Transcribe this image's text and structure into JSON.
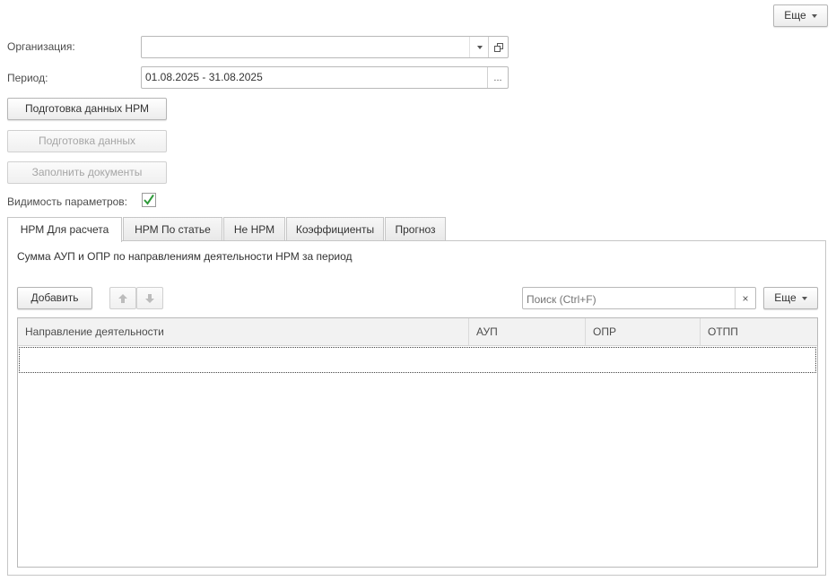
{
  "top_more": {
    "label": "Еще"
  },
  "form": {
    "organization": {
      "label": "Организация:",
      "value": ""
    },
    "period": {
      "label": "Период:",
      "value": "01.08.2025 - 31.08.2025",
      "button": "..."
    },
    "buttons": {
      "prepare_nrm": "Подготовка данных НРМ",
      "prepare_data": "Подготовка данных",
      "fill_docs": "Заполнить документы"
    },
    "visibility": {
      "label": "Видимость параметров:",
      "checked": true
    }
  },
  "tabs": [
    {
      "label": "НРМ Для расчета",
      "active": true
    },
    {
      "label": "НРМ По статье",
      "active": false
    },
    {
      "label": "Не НРМ",
      "active": false
    },
    {
      "label": "Коэффициенты",
      "active": false
    },
    {
      "label": "Прогноз",
      "active": false
    }
  ],
  "panel": {
    "caption": "Сумма АУП и ОПР по направлениям деятельности НРМ за период",
    "add_label": "Добавить",
    "search_placeholder": "Поиск (Ctrl+F)",
    "more_label": "Еще"
  },
  "table": {
    "columns": [
      "Направление деятельности",
      "АУП",
      "ОПР",
      "ОТПП"
    ],
    "rows": []
  }
}
